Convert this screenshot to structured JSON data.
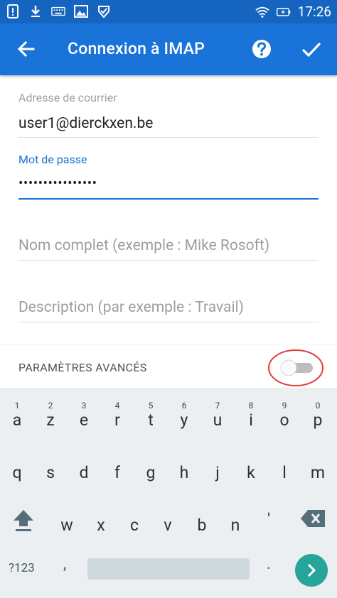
{
  "status_bar": {
    "time": "17:26",
    "icons": [
      "alert-icon",
      "download-icon",
      "keyboard-icon",
      "image-icon",
      "check-badge-icon",
      "wifi-icon",
      "battery-charging-icon"
    ]
  },
  "app_bar": {
    "title": "Connexion à IMAP"
  },
  "form": {
    "email": {
      "label": "Adresse de courrier",
      "value": "user1@dierckxen.be"
    },
    "password": {
      "label": "Mot de passe",
      "value": "••••••••••••••••"
    },
    "full_name": {
      "placeholder": "Nom complet (exemple : Mike Rosoft)"
    },
    "description": {
      "placeholder": "Description (par exemple : Travail)"
    },
    "advanced": {
      "label": "PARAMÈTRES AVANCÉS",
      "enabled": false
    }
  },
  "colors": {
    "status_bar": "#1565c0",
    "app_bar": "#1a73d9",
    "accent": "#1976d2",
    "highlight_ring": "#e53935",
    "enter_key": "#26a69a"
  },
  "keyboard": {
    "row1": [
      {
        "ch": "a",
        "hint": "1"
      },
      {
        "ch": "z",
        "hint": "2"
      },
      {
        "ch": "e",
        "hint": "3"
      },
      {
        "ch": "r",
        "hint": "4"
      },
      {
        "ch": "t",
        "hint": "5"
      },
      {
        "ch": "y",
        "hint": "6"
      },
      {
        "ch": "u",
        "hint": "7"
      },
      {
        "ch": "i",
        "hint": "8"
      },
      {
        "ch": "o",
        "hint": "9"
      },
      {
        "ch": "p",
        "hint": "0"
      }
    ],
    "row2": [
      "q",
      "s",
      "d",
      "f",
      "g",
      "h",
      "j",
      "k",
      "l",
      "m"
    ],
    "row3": [
      "w",
      "x",
      "c",
      "v",
      "b",
      "n",
      "'"
    ],
    "symbols_label": "?123",
    "comma": ",",
    "period": "."
  }
}
